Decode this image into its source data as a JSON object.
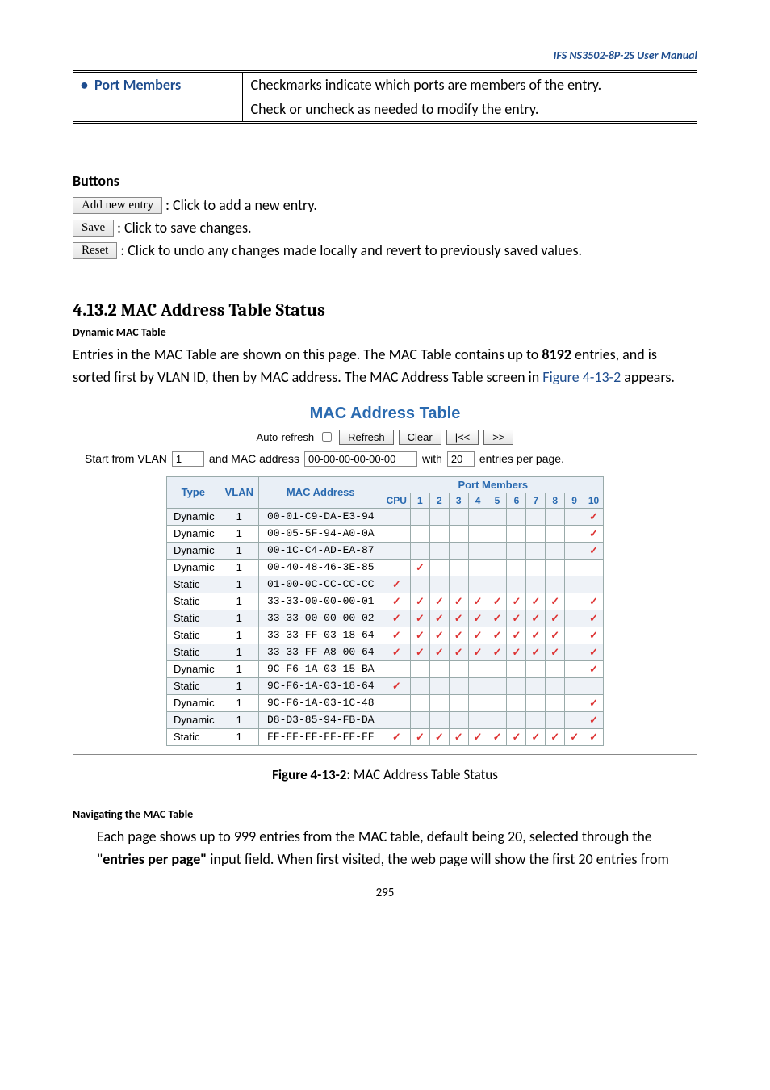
{
  "doc_header": "IFS NS3502-8P-2S  User Manual",
  "def_table": {
    "left_label": "Port Members",
    "right_line1": "Checkmarks indicate which ports are members of the entry.",
    "right_line2": "Check or uncheck as needed to modify the entry."
  },
  "buttons_section": {
    "title": "Buttons",
    "add_btn": "Add new entry",
    "add_text": ": Click to add a new entry.",
    "save_btn": "Save",
    "save_text": ": Click to save changes.",
    "reset_btn": "Reset",
    "reset_text": ": Click to undo any changes made locally and revert to previously saved values."
  },
  "section": {
    "number_title": "4.13.2 MAC Address Table Status",
    "sub1": "Dynamic MAC Table",
    "para1a": "Entries in the MAC Table are shown on this page. The MAC Table contains up to ",
    "para1_bold": "8192",
    "para1b": " entries, and is sorted first by VLAN ID, then by MAC address. The MAC Address Table screen in ",
    "para1_link": "Figure 4-13-2",
    "para1c": " appears."
  },
  "mac_panel": {
    "title": "MAC Address Table",
    "auto_refresh_label": "Auto-refresh",
    "buttons": {
      "refresh": "Refresh",
      "clear": "Clear",
      "prev": "|<<",
      "next": ">>"
    },
    "row2": {
      "start_label": "Start from VLAN",
      "vlan_value": "1",
      "and_mac_label": "and MAC address",
      "mac_value": "00-00-00-00-00-00",
      "with_label": "with",
      "count_value": "20",
      "entries_label": "entries per page."
    },
    "headers": {
      "group": "Port Members",
      "type": "Type",
      "vlan": "VLAN",
      "mac": "MAC Address",
      "ports": [
        "CPU",
        "1",
        "2",
        "3",
        "4",
        "5",
        "6",
        "7",
        "8",
        "9",
        "10"
      ]
    },
    "rows": [
      {
        "type": "Dynamic",
        "vlan": "1",
        "mac": "00-01-C9-DA-E3-94",
        "ports": [
          0,
          0,
          0,
          0,
          0,
          0,
          0,
          0,
          0,
          0,
          1
        ]
      },
      {
        "type": "Dynamic",
        "vlan": "1",
        "mac": "00-05-5F-94-A0-0A",
        "ports": [
          0,
          0,
          0,
          0,
          0,
          0,
          0,
          0,
          0,
          0,
          1
        ]
      },
      {
        "type": "Dynamic",
        "vlan": "1",
        "mac": "00-1C-C4-AD-EA-87",
        "ports": [
          0,
          0,
          0,
          0,
          0,
          0,
          0,
          0,
          0,
          0,
          1
        ]
      },
      {
        "type": "Dynamic",
        "vlan": "1",
        "mac": "00-40-48-46-3E-85",
        "ports": [
          0,
          1,
          0,
          0,
          0,
          0,
          0,
          0,
          0,
          0,
          0
        ]
      },
      {
        "type": "Static",
        "vlan": "1",
        "mac": "01-00-0C-CC-CC-CC",
        "ports": [
          1,
          0,
          0,
          0,
          0,
          0,
          0,
          0,
          0,
          0,
          0
        ]
      },
      {
        "type": "Static",
        "vlan": "1",
        "mac": "33-33-00-00-00-01",
        "ports": [
          1,
          1,
          1,
          1,
          1,
          1,
          1,
          1,
          1,
          0,
          1
        ]
      },
      {
        "type": "Static",
        "vlan": "1",
        "mac": "33-33-00-00-00-02",
        "ports": [
          1,
          1,
          1,
          1,
          1,
          1,
          1,
          1,
          1,
          0,
          1
        ]
      },
      {
        "type": "Static",
        "vlan": "1",
        "mac": "33-33-FF-03-18-64",
        "ports": [
          1,
          1,
          1,
          1,
          1,
          1,
          1,
          1,
          1,
          0,
          1
        ]
      },
      {
        "type": "Static",
        "vlan": "1",
        "mac": "33-33-FF-A8-00-64",
        "ports": [
          1,
          1,
          1,
          1,
          1,
          1,
          1,
          1,
          1,
          0,
          1
        ]
      },
      {
        "type": "Dynamic",
        "vlan": "1",
        "mac": "9C-F6-1A-03-15-BA",
        "ports": [
          0,
          0,
          0,
          0,
          0,
          0,
          0,
          0,
          0,
          0,
          1
        ]
      },
      {
        "type": "Static",
        "vlan": "1",
        "mac": "9C-F6-1A-03-18-64",
        "ports": [
          1,
          0,
          0,
          0,
          0,
          0,
          0,
          0,
          0,
          0,
          0
        ]
      },
      {
        "type": "Dynamic",
        "vlan": "1",
        "mac": "9C-F6-1A-03-1C-48",
        "ports": [
          0,
          0,
          0,
          0,
          0,
          0,
          0,
          0,
          0,
          0,
          1
        ]
      },
      {
        "type": "Dynamic",
        "vlan": "1",
        "mac": "D8-D3-85-94-FB-DA",
        "ports": [
          0,
          0,
          0,
          0,
          0,
          0,
          0,
          0,
          0,
          0,
          1
        ]
      },
      {
        "type": "Static",
        "vlan": "1",
        "mac": "FF-FF-FF-FF-FF-FF",
        "ports": [
          1,
          1,
          1,
          1,
          1,
          1,
          1,
          1,
          1,
          1,
          1
        ]
      }
    ]
  },
  "figure_caption": {
    "bold": "Figure 4-13-2:",
    "rest": " MAC Address Table Status"
  },
  "nav_section": {
    "title": "Navigating the MAC Table",
    "para_a": "Each page shows up to 999 entries from the MAC table, default being 20, selected through the \"",
    "para_bold": "entries per page\"",
    "para_b": " input field. When first visited, the web page will show the first 20 entries from"
  },
  "page_number": "295"
}
